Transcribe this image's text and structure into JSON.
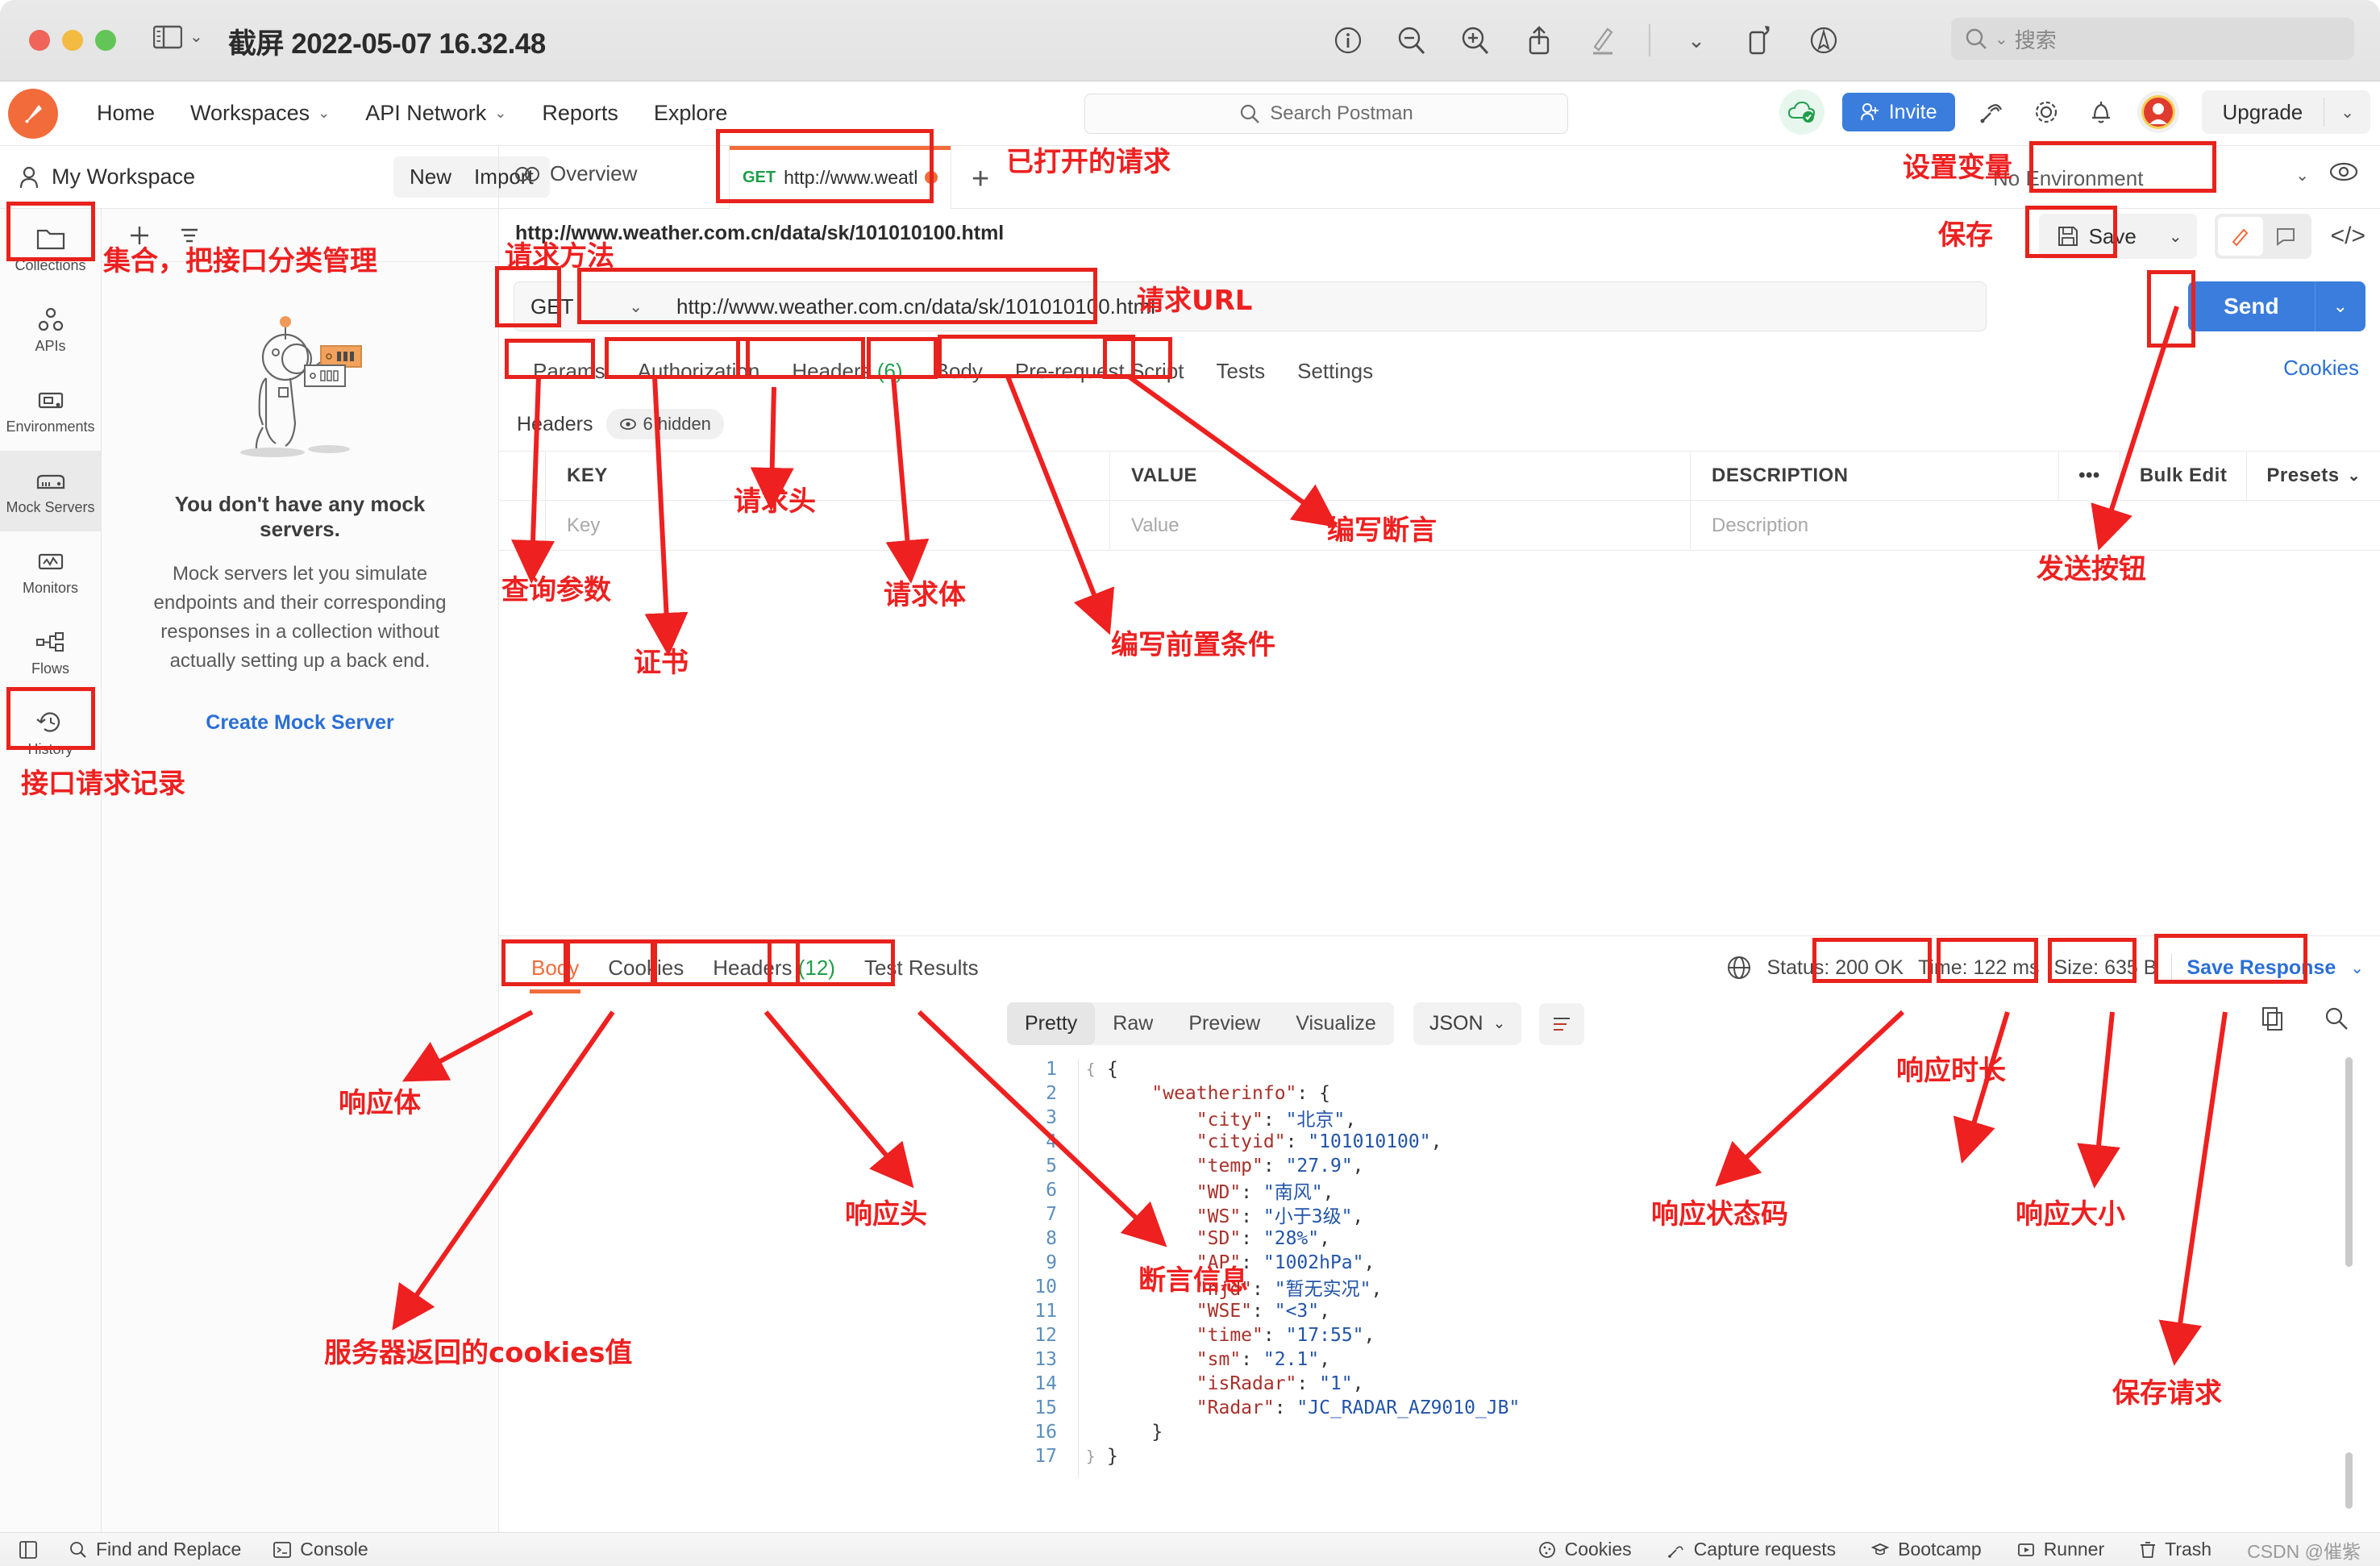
{
  "window": {
    "title": "截屏 2022-05-07 16.32.48",
    "search_placeholder": "搜索",
    "tools": [
      "info-icon",
      "zoom-out-icon",
      "zoom-in-icon",
      "share-icon",
      "markup-icon",
      "chevron-down-icon",
      "rotate-icon",
      "annotate-icon"
    ]
  },
  "topnav": {
    "items": [
      {
        "label": "Home",
        "caret": false
      },
      {
        "label": "Workspaces",
        "caret": true
      },
      {
        "label": "API Network",
        "caret": true
      },
      {
        "label": "Reports",
        "caret": false
      },
      {
        "label": "Explore",
        "caret": false
      }
    ],
    "search_placeholder": "Search Postman",
    "invite_label": "Invite",
    "upgrade_label": "Upgrade"
  },
  "workspacebar": {
    "workspace_name": "My Workspace",
    "new_label": "New",
    "import_label": "Import",
    "overview_label": "Overview",
    "request_tab": {
      "method": "GET",
      "url": "http://www.weather.co"
    },
    "environment": "No Environment"
  },
  "rail": {
    "items": [
      {
        "label": "Collections",
        "icon": "folder-icon",
        "active": false
      },
      {
        "label": "APIs",
        "icon": "apis-icon",
        "active": false
      },
      {
        "label": "Environments",
        "icon": "environments-icon",
        "active": false
      },
      {
        "label": "Mock Servers",
        "icon": "mock-servers-icon",
        "active": true
      },
      {
        "label": "Monitors",
        "icon": "monitors-icon",
        "active": false
      },
      {
        "label": "Flows",
        "icon": "flows-icon",
        "active": false
      },
      {
        "label": "History",
        "icon": "history-icon",
        "active": false
      }
    ]
  },
  "mock_panel": {
    "title": "You don't have any mock servers.",
    "description": "Mock servers let you simulate endpoints and their corresponding responses in a collection without actually setting up a back end.",
    "cta": "Create Mock Server"
  },
  "request": {
    "breadcrumb_url": "http://www.weather.com.cn/data/sk/101010100.html",
    "method": "GET",
    "url": "http://www.weather.com.cn/data/sk/101010100.html",
    "save_label": "Save",
    "send_label": "Send",
    "cookies_link": "Cookies",
    "tabs": [
      {
        "label": "Params",
        "count": "",
        "active": false
      },
      {
        "label": "Authorization",
        "count": "",
        "active": false
      },
      {
        "label": "Headers",
        "count": "(6)",
        "active": true
      },
      {
        "label": "Body",
        "count": "",
        "active": false
      },
      {
        "label": "Pre-request Script",
        "count": "",
        "active": false
      },
      {
        "label": "Tests",
        "count": "",
        "active": false
      },
      {
        "label": "Settings",
        "count": "",
        "active": false
      }
    ],
    "headers_section_label": "Headers",
    "hidden_pill": "6 hidden",
    "table": {
      "columns": [
        "KEY",
        "VALUE",
        "DESCRIPTION"
      ],
      "placeholder_row": [
        "Key",
        "Value",
        "Description"
      ],
      "bulk_edit": "Bulk Edit",
      "presets": "Presets",
      "more": "•••"
    }
  },
  "response": {
    "tabs": [
      {
        "label": "Body",
        "count": "",
        "active": true
      },
      {
        "label": "Cookies",
        "count": "",
        "active": false
      },
      {
        "label": "Headers",
        "count": "(12)",
        "active": false
      },
      {
        "label": "Test Results",
        "count": "",
        "active": false
      }
    ],
    "status": "Status: 200 OK",
    "status_code": "200 OK",
    "time": "Time: 122 ms",
    "time_value": "122 ms",
    "size": "Size: 635 B",
    "size_value": "635 B",
    "save_response": "Save Response",
    "formats": [
      {
        "label": "Pretty",
        "active": true
      },
      {
        "label": "Raw",
        "active": false
      },
      {
        "label": "Preview",
        "active": false
      },
      {
        "label": "Visualize",
        "active": false
      }
    ],
    "content_type": "JSON",
    "body_lines": [
      {
        "n": 1,
        "fold": "{",
        "text": "{"
      },
      {
        "n": 2,
        "fold": "",
        "text": "    \"weatherinfo\": {"
      },
      {
        "n": 3,
        "fold": "",
        "text": "        \"city\": \"北京\","
      },
      {
        "n": 4,
        "fold": "",
        "text": "        \"cityid\": \"101010100\","
      },
      {
        "n": 5,
        "fold": "",
        "text": "        \"temp\": \"27.9\","
      },
      {
        "n": 6,
        "fold": "",
        "text": "        \"WD\": \"南风\","
      },
      {
        "n": 7,
        "fold": "",
        "text": "        \"WS\": \"小于3级\","
      },
      {
        "n": 8,
        "fold": "",
        "text": "        \"SD\": \"28%\","
      },
      {
        "n": 9,
        "fold": "",
        "text": "        \"AP\": \"1002hPa\","
      },
      {
        "n": 10,
        "fold": "",
        "text": "        \"njd\": \"暂无实况\","
      },
      {
        "n": 11,
        "fold": "",
        "text": "        \"WSE\": \"<3\","
      },
      {
        "n": 12,
        "fold": "",
        "text": "        \"time\": \"17:55\","
      },
      {
        "n": 13,
        "fold": "",
        "text": "        \"sm\": \"2.1\","
      },
      {
        "n": 14,
        "fold": "",
        "text": "        \"isRadar\": \"1\","
      },
      {
        "n": 15,
        "fold": "",
        "text": "        \"Radar\": \"JC_RADAR_AZ9010_JB\""
      },
      {
        "n": 16,
        "fold": "",
        "text": "    }"
      },
      {
        "n": 17,
        "fold": "}",
        "text": "}"
      }
    ],
    "json_payload": {
      "weatherinfo": {
        "city": "北京",
        "cityid": "101010100",
        "temp": "27.9",
        "WD": "南风",
        "WS": "小于3级",
        "SD": "28%",
        "AP": "1002hPa",
        "njd": "暂无实况",
        "WSE": "<3",
        "time": "17:55",
        "sm": "2.1",
        "isRadar": "1",
        "Radar": "JC_RADAR_AZ9010_JB"
      }
    }
  },
  "statusbar": {
    "left": [
      {
        "label": "Find and Replace",
        "icon": "search-icon"
      },
      {
        "label": "Console",
        "icon": "console-icon"
      }
    ],
    "right": [
      {
        "label": "Cookies",
        "icon": "cookie-icon"
      },
      {
        "label": "Capture requests",
        "icon": "satellite-icon"
      },
      {
        "label": "Bootcamp",
        "icon": "bootcamp-icon"
      },
      {
        "label": "Runner",
        "icon": "runner-icon"
      },
      {
        "label": "Trash",
        "icon": "trash-icon"
      }
    ],
    "watermark": "CSDN @催紫"
  },
  "annotations": {
    "color": "#ee2020",
    "labels": [
      {
        "id": "collections",
        "text": "集合，把接口分类管理"
      },
      {
        "id": "history",
        "text": "接口请求记录"
      },
      {
        "id": "opened-request",
        "text": "已打开的请求"
      },
      {
        "id": "set-variables",
        "text": "设置变量"
      },
      {
        "id": "save",
        "text": "保存"
      },
      {
        "id": "method",
        "text": "请求方法"
      },
      {
        "id": "url",
        "text": "请求URL"
      },
      {
        "id": "query-params",
        "text": "查询参数"
      },
      {
        "id": "certificate",
        "text": "证书"
      },
      {
        "id": "request-headers",
        "text": "请求头"
      },
      {
        "id": "request-body",
        "text": "请求体"
      },
      {
        "id": "pre-request",
        "text": "编写前置条件"
      },
      {
        "id": "assertions",
        "text": "编写断言"
      },
      {
        "id": "send-button",
        "text": "发送按钮"
      },
      {
        "id": "response-body",
        "text": "响应体"
      },
      {
        "id": "server-cookies",
        "text": "服务器返回的cookies值"
      },
      {
        "id": "response-headers",
        "text": "响应头"
      },
      {
        "id": "assertion-info",
        "text": "断言信息"
      },
      {
        "id": "status-code",
        "text": "响应状态码"
      },
      {
        "id": "response-time",
        "text": "响应时长"
      },
      {
        "id": "response-size",
        "text": "响应大小"
      },
      {
        "id": "save-request",
        "text": "保存请求"
      }
    ]
  }
}
